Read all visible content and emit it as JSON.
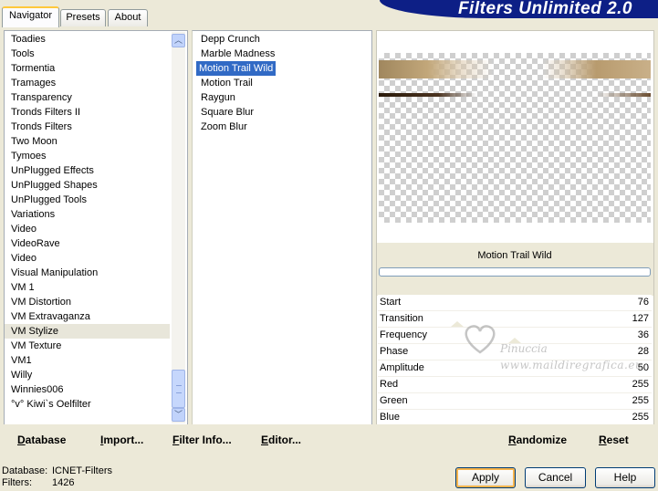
{
  "tabs": [
    {
      "label": "Navigator",
      "active": true
    },
    {
      "label": "Presets",
      "active": false
    },
    {
      "label": "About",
      "active": false
    }
  ],
  "banner": {
    "title": "Filters Unlimited 2.0"
  },
  "categories": {
    "items": [
      "Toadies",
      "Tools",
      "Tormentia",
      "Tramages",
      "Transparency",
      "Tronds Filters II",
      "Tronds Filters",
      "Two Moon",
      "Tymoes",
      "UnPlugged Effects",
      "UnPlugged Shapes",
      "UnPlugged Tools",
      "Variations",
      "Video",
      "VideoRave",
      "Video",
      "Visual Manipulation",
      "VM 1",
      "VM Distortion",
      "VM Extravaganza",
      "VM Stylize",
      "VM Texture",
      "VM1",
      "Willy",
      "Winnies006",
      "°v° Kiwi`s Oelfilter"
    ],
    "selected": "VM Stylize"
  },
  "filters": {
    "items": [
      "Depp Crunch",
      "Marble Madness",
      "Motion Trail Wild",
      "Motion Trail",
      "Raygun",
      "Square Blur",
      "Zoom Blur"
    ],
    "selected": "Motion Trail Wild"
  },
  "left_buttons": {
    "database": "Database",
    "import": "Import...",
    "filter_info": "Filter Info...",
    "editor": "Editor..."
  },
  "right_buttons": {
    "randomize": "Randomize",
    "reset": "Reset"
  },
  "preview": {
    "filter_name": "Motion Trail Wild"
  },
  "parameters": [
    {
      "label": "Start",
      "value": "76"
    },
    {
      "label": "Transition",
      "value": "127"
    },
    {
      "label": "Frequency",
      "value": "36"
    },
    {
      "label": "Phase",
      "value": "28"
    },
    {
      "label": "Amplitude",
      "value": "50"
    },
    {
      "label": "Red",
      "value": "255"
    },
    {
      "label": "Green",
      "value": "255"
    },
    {
      "label": "Blue",
      "value": "255"
    }
  ],
  "watermark": {
    "line1": "Pinuccia",
    "line2": "www.maildiregrafica.eu"
  },
  "status": {
    "database_label": "Database:",
    "database_value": "ICNET-Filters",
    "filters_label": "Filters:",
    "filters_value": "1426"
  },
  "dialog_buttons": {
    "apply": "Apply",
    "cancel": "Cancel",
    "help": "Help"
  }
}
